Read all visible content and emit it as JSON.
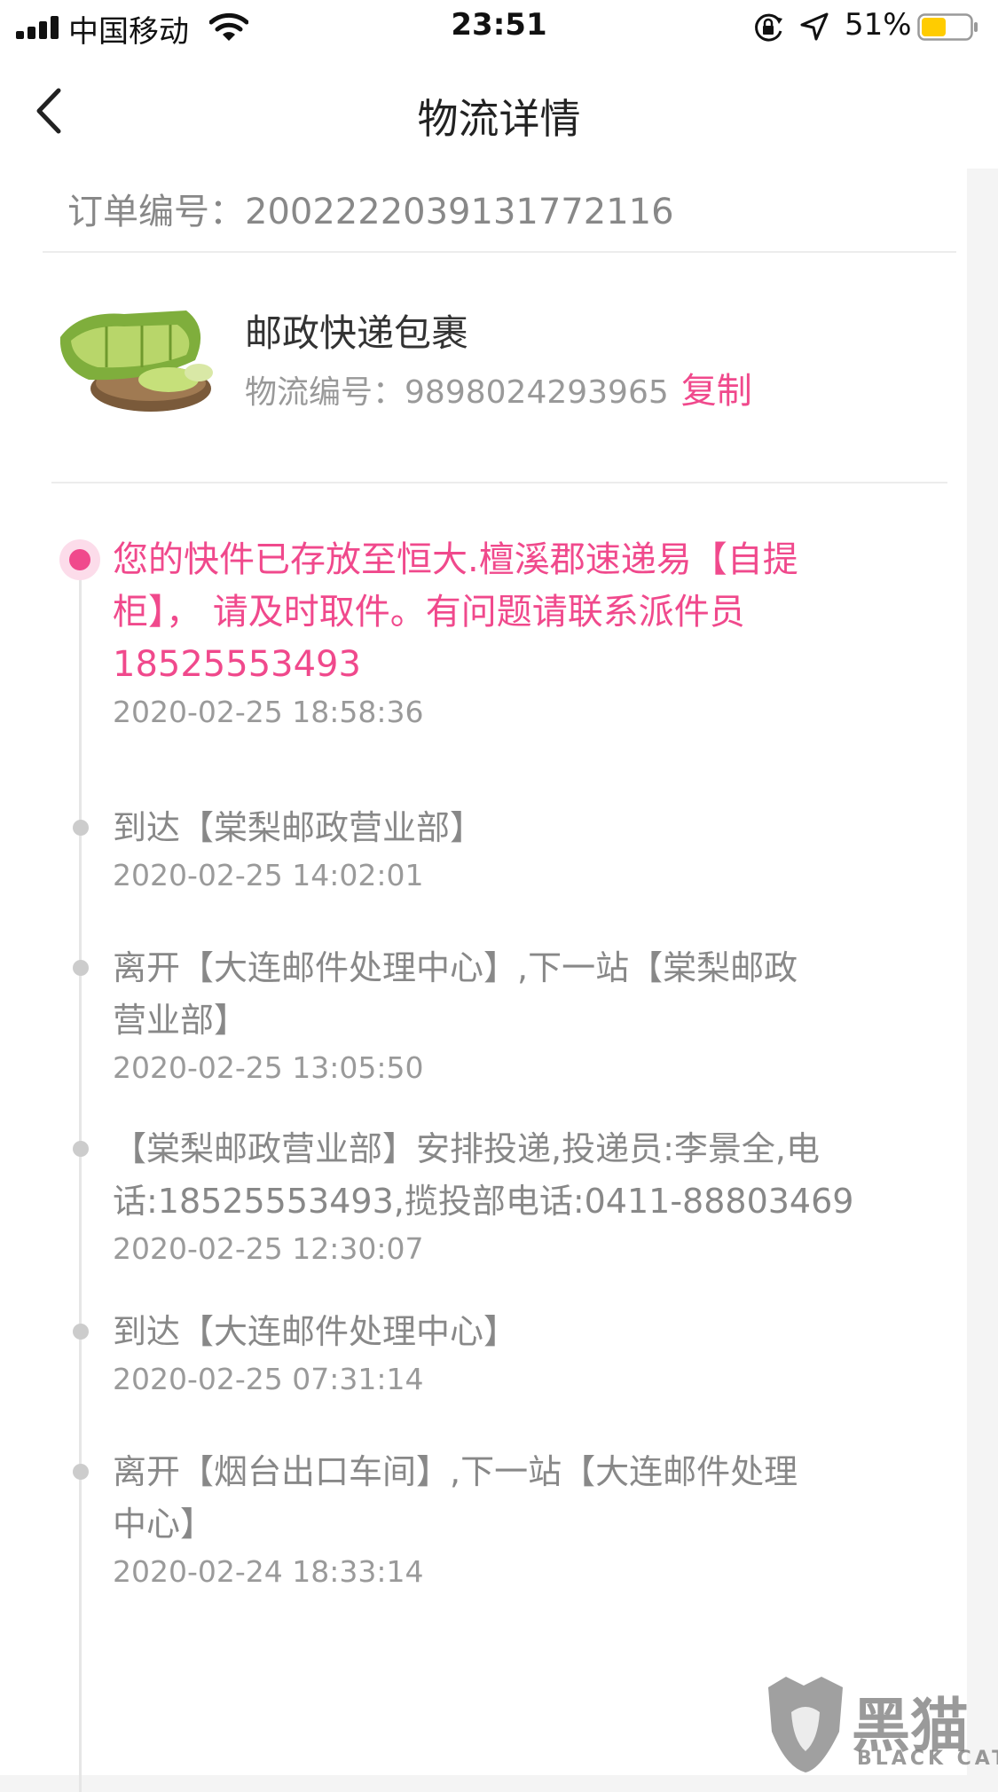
{
  "status_bar": {
    "carrier": "中国移动",
    "time": "23:51",
    "battery_percent": "51%",
    "battery_level": 0.51,
    "battery_color": "#ffcc00"
  },
  "nav": {
    "title": "物流详情",
    "back_icon": "chevron-left-icon"
  },
  "order": {
    "label": "订单编号：",
    "number": "2002222039131772116"
  },
  "shipment": {
    "carrier_name": "邮政快递包裹",
    "tracking_label": "物流编号：",
    "tracking_number": "9898024293965",
    "copy_label": "复制",
    "accent_color": "#f0498c"
  },
  "timeline": [
    {
      "lines": [
        "您的快件已存放至恒大.檀溪郡速递易【自提",
        "柜】， 请及时取件。有问题请联系派件员",
        "18525553493"
      ],
      "time": "2020-02-25 18:58:36",
      "active": true
    },
    {
      "lines": [
        "到达【棠梨邮政营业部】"
      ],
      "time": "2020-02-25 14:02:01",
      "active": false
    },
    {
      "lines": [
        "离开【大连邮件处理中心】,下一站【棠梨邮政",
        "营业部】"
      ],
      "time": "2020-02-25 13:05:50",
      "active": false
    },
    {
      "lines": [
        "【棠梨邮政营业部】安排投递,投递员:李景全,电",
        "话:18525553493,揽投部电话:0411-88803469"
      ],
      "time": "2020-02-25 12:30:07",
      "active": false
    },
    {
      "lines": [
        "到达【大连邮件处理中心】"
      ],
      "time": "2020-02-25 07:31:14",
      "active": false
    },
    {
      "lines": [
        "离开【烟台出口车间】,下一站【大连邮件处理",
        "中心】"
      ],
      "time": "2020-02-24 18:33:14",
      "active": false
    }
  ],
  "watermark": {
    "text": "黑猫",
    "sub": "BLACK CAT"
  }
}
